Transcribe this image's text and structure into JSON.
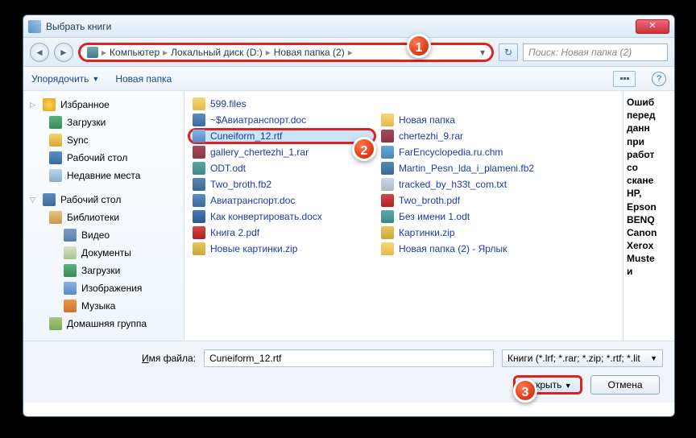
{
  "window": {
    "title": "Выбрать книги"
  },
  "nav": {
    "crumbs": [
      "Компьютер",
      "Локальный диск (D:)",
      "Новая папка (2)"
    ],
    "search_placeholder": "Поиск: Новая папка (2)"
  },
  "toolbar": {
    "organize": "Упорядочить",
    "newfolder": "Новая папка"
  },
  "sidebar": {
    "fav": "Избранное",
    "downloads": "Загрузки",
    "sync": "Sync",
    "desktop": "Рабочий стол",
    "recent": "Недавние места",
    "desktop2": "Рабочий стол",
    "libs": "Библиотеки",
    "video": "Видео",
    "docs": "Документы",
    "downloads2": "Загрузки",
    "images": "Изображения",
    "music": "Музыка",
    "homegroup": "Домашняя группа"
  },
  "files": {
    "col1": [
      {
        "n": "599.files",
        "t": "folder"
      },
      {
        "n": "~$Авиатранспорт.doc",
        "t": "doc"
      },
      {
        "n": "Cuneiform_12.rtf",
        "t": "rtf",
        "sel": true,
        "mark": true
      },
      {
        "n": "gallery_chertezhi_1.rar",
        "t": "rar"
      },
      {
        "n": "ODT.odt",
        "t": "odt"
      },
      {
        "n": "Two_broth.fb2",
        "t": "fb2"
      },
      {
        "n": "Авиатранспорт.doc",
        "t": "doc"
      },
      {
        "n": "Как конвертировать.docx",
        "t": "docx"
      },
      {
        "n": "Книга 2.pdf",
        "t": "pdf"
      },
      {
        "n": "Новые картинки.zip",
        "t": "zip"
      }
    ],
    "col2": [
      {
        "n": "Новая папка",
        "t": "folder"
      },
      {
        "n": "chertezhi_9.rar",
        "t": "rar"
      },
      {
        "n": "FarEncyclopedia.ru.chm",
        "t": "chm"
      },
      {
        "n": "Martin_Pesn_lda_i_plameni.fb2",
        "t": "fb2"
      },
      {
        "n": "tracked_by_h33t_com.txt",
        "t": "txt"
      },
      {
        "n": "Two_broth.pdf",
        "t": "pdf"
      },
      {
        "n": "Без имени 1.odt",
        "t": "odt"
      },
      {
        "n": "Картинки.zip",
        "t": "zip"
      },
      {
        "n": "Новая папка (2) - Ярлык",
        "t": "lnk"
      }
    ]
  },
  "preview": [
    "Ошиб",
    "перед",
    "данн",
    "при",
    "работ",
    "со",
    "скане",
    "HP,",
    "Epson",
    "BENQ",
    "Canon",
    "Xerox",
    "Muste",
    "и"
  ],
  "bottom": {
    "fn_label_pre": "Имя файла",
    "fn_value": "Cuneiform_12.rtf",
    "filter": "Книги (*.lrf; *.rar; *.zip; *.rtf; *.lit",
    "open": "Открыть",
    "cancel": "Отмена"
  },
  "badges": {
    "b1": "1",
    "b2": "2",
    "b3": "3"
  }
}
